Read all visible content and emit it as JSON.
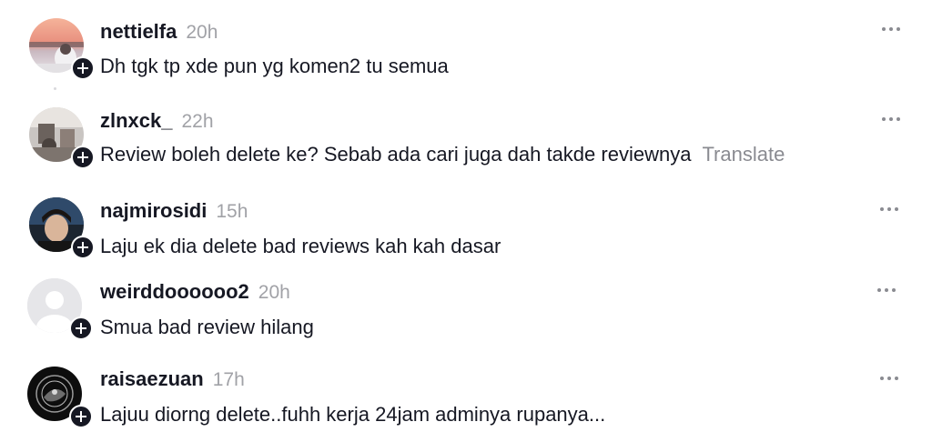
{
  "comments": [
    {
      "username": "nettielfa",
      "time": "20h",
      "text": "Dh tgk tp xde pun yg komen2 tu semua",
      "translate": "",
      "avatar_icon": "sunset-photo-avatar",
      "follow_icon": "plus-icon",
      "more_icon": "more-options-icon"
    },
    {
      "username": "zlnxck_",
      "time": "22h",
      "text": "Review boleh delete ke? Sebab ada cari juga dah takde reviewnya",
      "translate": "Translate",
      "avatar_icon": "room-photo-avatar",
      "follow_icon": "plus-icon",
      "more_icon": "more-options-icon"
    },
    {
      "username": "najmirosidi",
      "time": "15h",
      "text": "Laju ek dia delete bad reviews kah kah dasar",
      "translate": "",
      "avatar_icon": "portrait-photo-avatar",
      "follow_icon": "plus-icon",
      "more_icon": "more-options-icon"
    },
    {
      "username": "weirddoooooo2",
      "time": "20h",
      "text": "Smua bad review hilang",
      "translate": "",
      "avatar_icon": "default-user-avatar",
      "follow_icon": "plus-icon",
      "more_icon": "more-options-icon"
    },
    {
      "username": "raisaezuan",
      "time": "17h",
      "text": "Lajuu diorng delete..fuhh kerja 24jam adminya rupanya...",
      "translate": "",
      "avatar_icon": "logo-emblem-avatar",
      "follow_icon": "plus-icon",
      "more_icon": "more-options-icon"
    }
  ],
  "colors": {
    "text_primary": "#161823",
    "text_muted": "#a1a2a7",
    "badge_bg": "#161823"
  }
}
